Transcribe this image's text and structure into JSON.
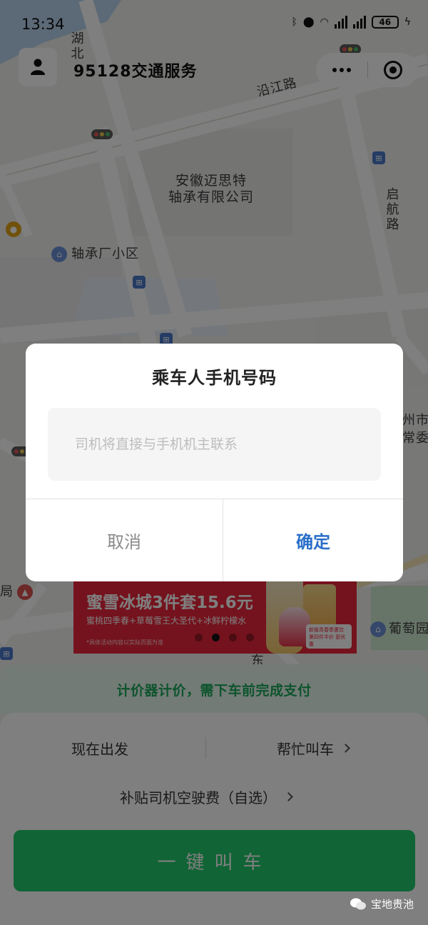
{
  "status_bar": {
    "time": "13:34",
    "battery": "46"
  },
  "header": {
    "title": "95128交通服务"
  },
  "map": {
    "labels": {
      "hubei_road": "湖北",
      "yanjiang_road": "沿江路",
      "company": "安徽迈思特\n轴承有限公司",
      "qihang_road": "启航路",
      "community": "轴承厂小区",
      "city_right": "州市\n常委",
      "bureau": "局",
      "grape_garden": "葡萄园",
      "east_fragment": "东"
    }
  },
  "banner": {
    "title": "蜜雪冰城3件套15.6元",
    "subtitle": "蜜桃四季春+草莓雪王大圣代+冰鲜柠檬水",
    "note": "*具体活动内容以实际页面为准",
    "sticker": "新版青春季惠饮 第四件半价 更优惠",
    "dots": [
      false,
      true,
      false,
      false
    ]
  },
  "panel": {
    "payment_notice": "计价器计价，需下车前完成支付",
    "depart_now": "现在出发",
    "help_call": "帮忙叫车",
    "subsidy": "补贴司机空驶费（自选）",
    "call_button": "一键叫车"
  },
  "dialog": {
    "title": "乘车人手机号码",
    "input_placeholder": "司机将直接与手机机主联系",
    "input_value": "",
    "cancel": "取消",
    "confirm": "确定"
  },
  "watermark": {
    "text": "宝地贵池"
  },
  "colors": {
    "accent_green": "#23c86a",
    "confirm_blue": "#2a6fc9",
    "banner_red": "#e8263b"
  }
}
